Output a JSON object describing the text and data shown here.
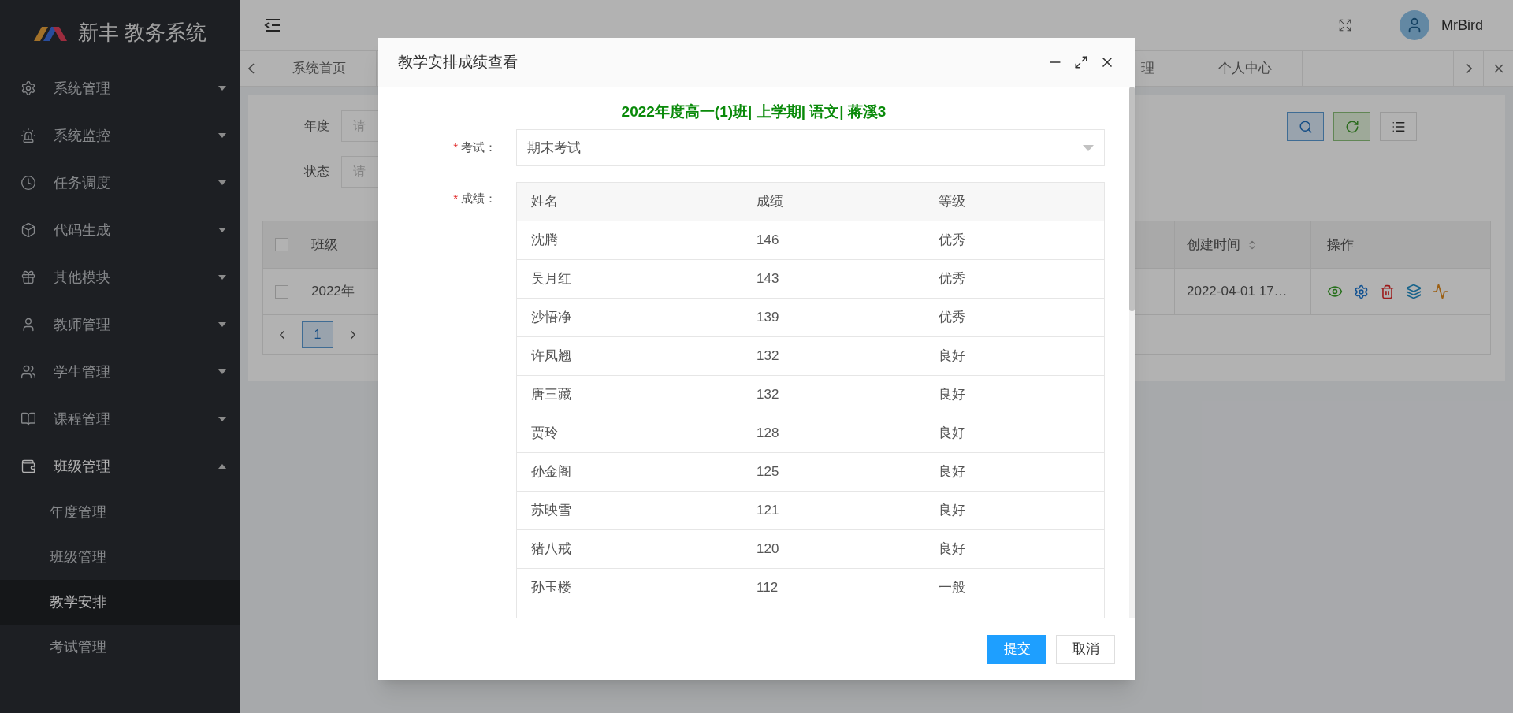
{
  "sidebar": {
    "logo": "新丰 教务系统",
    "items": [
      {
        "label": "系统管理",
        "expanded": false
      },
      {
        "label": "系统监控",
        "expanded": false
      },
      {
        "label": "任务调度",
        "expanded": false
      },
      {
        "label": "代码生成",
        "expanded": false
      },
      {
        "label": "其他模块",
        "expanded": false
      },
      {
        "label": "教师管理",
        "expanded": false
      },
      {
        "label": "学生管理",
        "expanded": false
      },
      {
        "label": "课程管理",
        "expanded": false
      },
      {
        "label": "班级管理",
        "expanded": true,
        "children": [
          {
            "label": "年度管理",
            "selected": false
          },
          {
            "label": "班级管理",
            "selected": false
          },
          {
            "label": "教学安排",
            "selected": true
          },
          {
            "label": "考试管理",
            "selected": false
          }
        ]
      }
    ]
  },
  "header": {
    "user": "MrBird"
  },
  "tabs": [
    {
      "label": "系统首页"
    },
    {
      "label": "理"
    },
    {
      "label": "个人中心"
    }
  ],
  "search": {
    "fields": [
      {
        "label": "年度",
        "placeholder": "请"
      },
      {
        "label": "状态",
        "placeholder": "请"
      }
    ]
  },
  "table": {
    "columns": [
      "班级",
      "创建时间",
      "操作"
    ],
    "all_checked": false,
    "rows": [
      {
        "checked": false,
        "class": "2022年",
        "created": "2022-04-01 17…"
      }
    ]
  },
  "pagination": {
    "pages": [
      {
        "label": "1",
        "selected": true
      }
    ]
  },
  "dialog": {
    "title": "教学安排成绩查看",
    "heading": "2022年度高一(1)班| 上学期| 语文| 蒋溪3",
    "exam": {
      "required_mark": "*",
      "label": "考试：",
      "value": "期末考试"
    },
    "scores": {
      "required_mark": "*",
      "label": "成绩：",
      "columns": [
        "姓名",
        "成绩",
        "等级"
      ],
      "rows": [
        [
          "沈腾",
          "146",
          "优秀"
        ],
        [
          "吴月红",
          "143",
          "优秀"
        ],
        [
          "沙悟净",
          "139",
          "优秀"
        ],
        [
          "许凤翘",
          "132",
          "良好"
        ],
        [
          "唐三藏",
          "132",
          "良好"
        ],
        [
          "贾玲",
          "128",
          "良好"
        ],
        [
          "孙金阁",
          "125",
          "良好"
        ],
        [
          "苏映雪",
          "121",
          "良好"
        ],
        [
          "猪八戒",
          "120",
          "良好"
        ],
        [
          "孙玉楼",
          "112",
          "一般"
        ]
      ]
    },
    "buttons": [
      "提交",
      "取消"
    ]
  }
}
